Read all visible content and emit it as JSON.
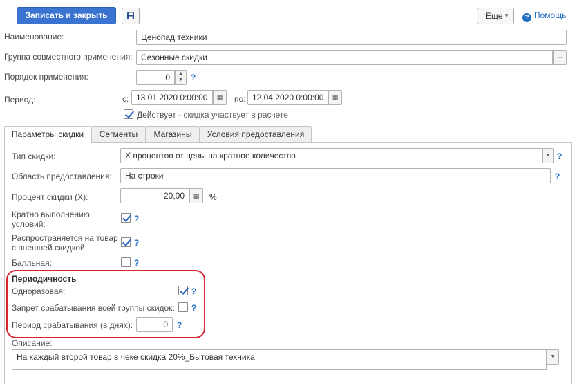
{
  "toolbar": {
    "save_close_label": "Записать и закрыть",
    "save_icon": "floppy-disk-icon",
    "more_label": "Еще",
    "help_label": "Помощь"
  },
  "header": {
    "name_label": "Наименование:",
    "name_value": "Ценопад техники",
    "group_label": "Группа совместного применения:",
    "group_value": "Сезонные скидки",
    "group_btn": "...",
    "order_label": "Порядок применения:",
    "order_value": "0",
    "period_label": "Период:",
    "period_from_label": "с:",
    "period_from_value": "13.01.2020  0:00:00",
    "period_to_label": "по:",
    "period_to_value": "12.04.2020  0:00:00",
    "active_label": "Действует",
    "active_hint": "- скидка участвует в расчете",
    "active_checked": true
  },
  "tabs": [
    {
      "label": "Параметры скидки",
      "active": true
    },
    {
      "label": "Сегменты",
      "active": false
    },
    {
      "label": "Магазины",
      "active": false
    },
    {
      "label": "Условия предоставления",
      "active": false
    }
  ],
  "params": {
    "discount_type_label": "Тип скидки:",
    "discount_type_value": "Х процентов от цены на кратное количество",
    "scope_label": "Область предоставления:",
    "scope_value": "На строки",
    "percent_label": "Процент скидки (Х):",
    "percent_value": "20,00",
    "percent_unit": "%",
    "multiple_label_1": "Кратно выполнению",
    "multiple_label_2": "условий:",
    "multiple_checked": true,
    "external_label_1": "Распространяется на товар",
    "external_label_2": "с внешней скидкой:",
    "external_checked": true,
    "points_label": "Балльная:",
    "points_checked": false
  },
  "periodicity": {
    "title": "Периодичность",
    "one_time_label": "Одноразовая:",
    "one_time_checked": true,
    "ban_group_label": "Запрет срабатывания всей группы скидок:",
    "ban_group_checked": false,
    "period_days_label": "Период срабатывания (в днях):",
    "period_days_value": "0"
  },
  "description": {
    "label": "Описание:",
    "value": "На каждый второй товар в чеке скидка 20%_Бытовая техника"
  },
  "help_mark": "?"
}
